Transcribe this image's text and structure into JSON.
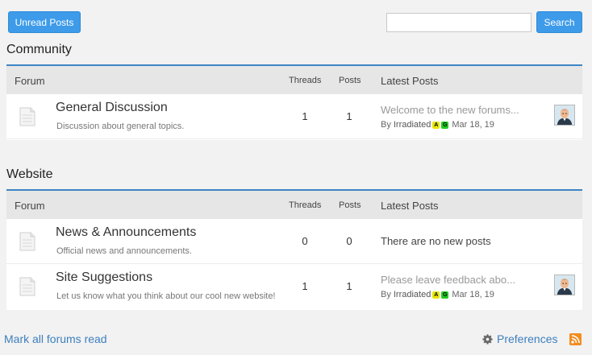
{
  "toolbar": {
    "unread_label": "Unread Posts",
    "search_placeholder": "",
    "search_value": "",
    "search_label": "Search"
  },
  "columns": {
    "forum": "Forum",
    "threads": "Threads",
    "posts": "Posts",
    "latest": "Latest Posts"
  },
  "sections": [
    {
      "title": "Community",
      "forums": [
        {
          "title": "General Discussion",
          "desc": "Discussion about general topics.",
          "threads": "1",
          "posts": "1",
          "latest_title": "Welcome to the new forums...",
          "latest_by": "By",
          "latest_user": "Irradiated",
          "badge_a": "A",
          "badge_g": "G",
          "latest_date": "Mar 18, 19"
        }
      ]
    },
    {
      "title": "Website",
      "forums": [
        {
          "title": "News & Announcements",
          "desc": "Official news and announcements.",
          "threads": "0",
          "posts": "0",
          "latest_none": "There are no new posts"
        },
        {
          "title": "Site Suggestions",
          "desc": "Let us know what you think about our cool new website!",
          "threads": "1",
          "posts": "1",
          "latest_title": "Please leave feedback abo...",
          "latest_by": "By",
          "latest_user": "Irradiated",
          "badge_a": "A",
          "badge_g": "G",
          "latest_date": "Mar 18, 19"
        }
      ]
    }
  ],
  "footer": {
    "mark_read": "Mark all forums read",
    "preferences": "Preferences"
  },
  "icons": {
    "forum": "document-icon",
    "preferences": "gear-icon",
    "feed": "rss-icon"
  },
  "colors": {
    "accent": "#3d9be9",
    "header_rule": "#3d85c6",
    "link": "#3d7fbd",
    "rss": "#f28d1f"
  }
}
